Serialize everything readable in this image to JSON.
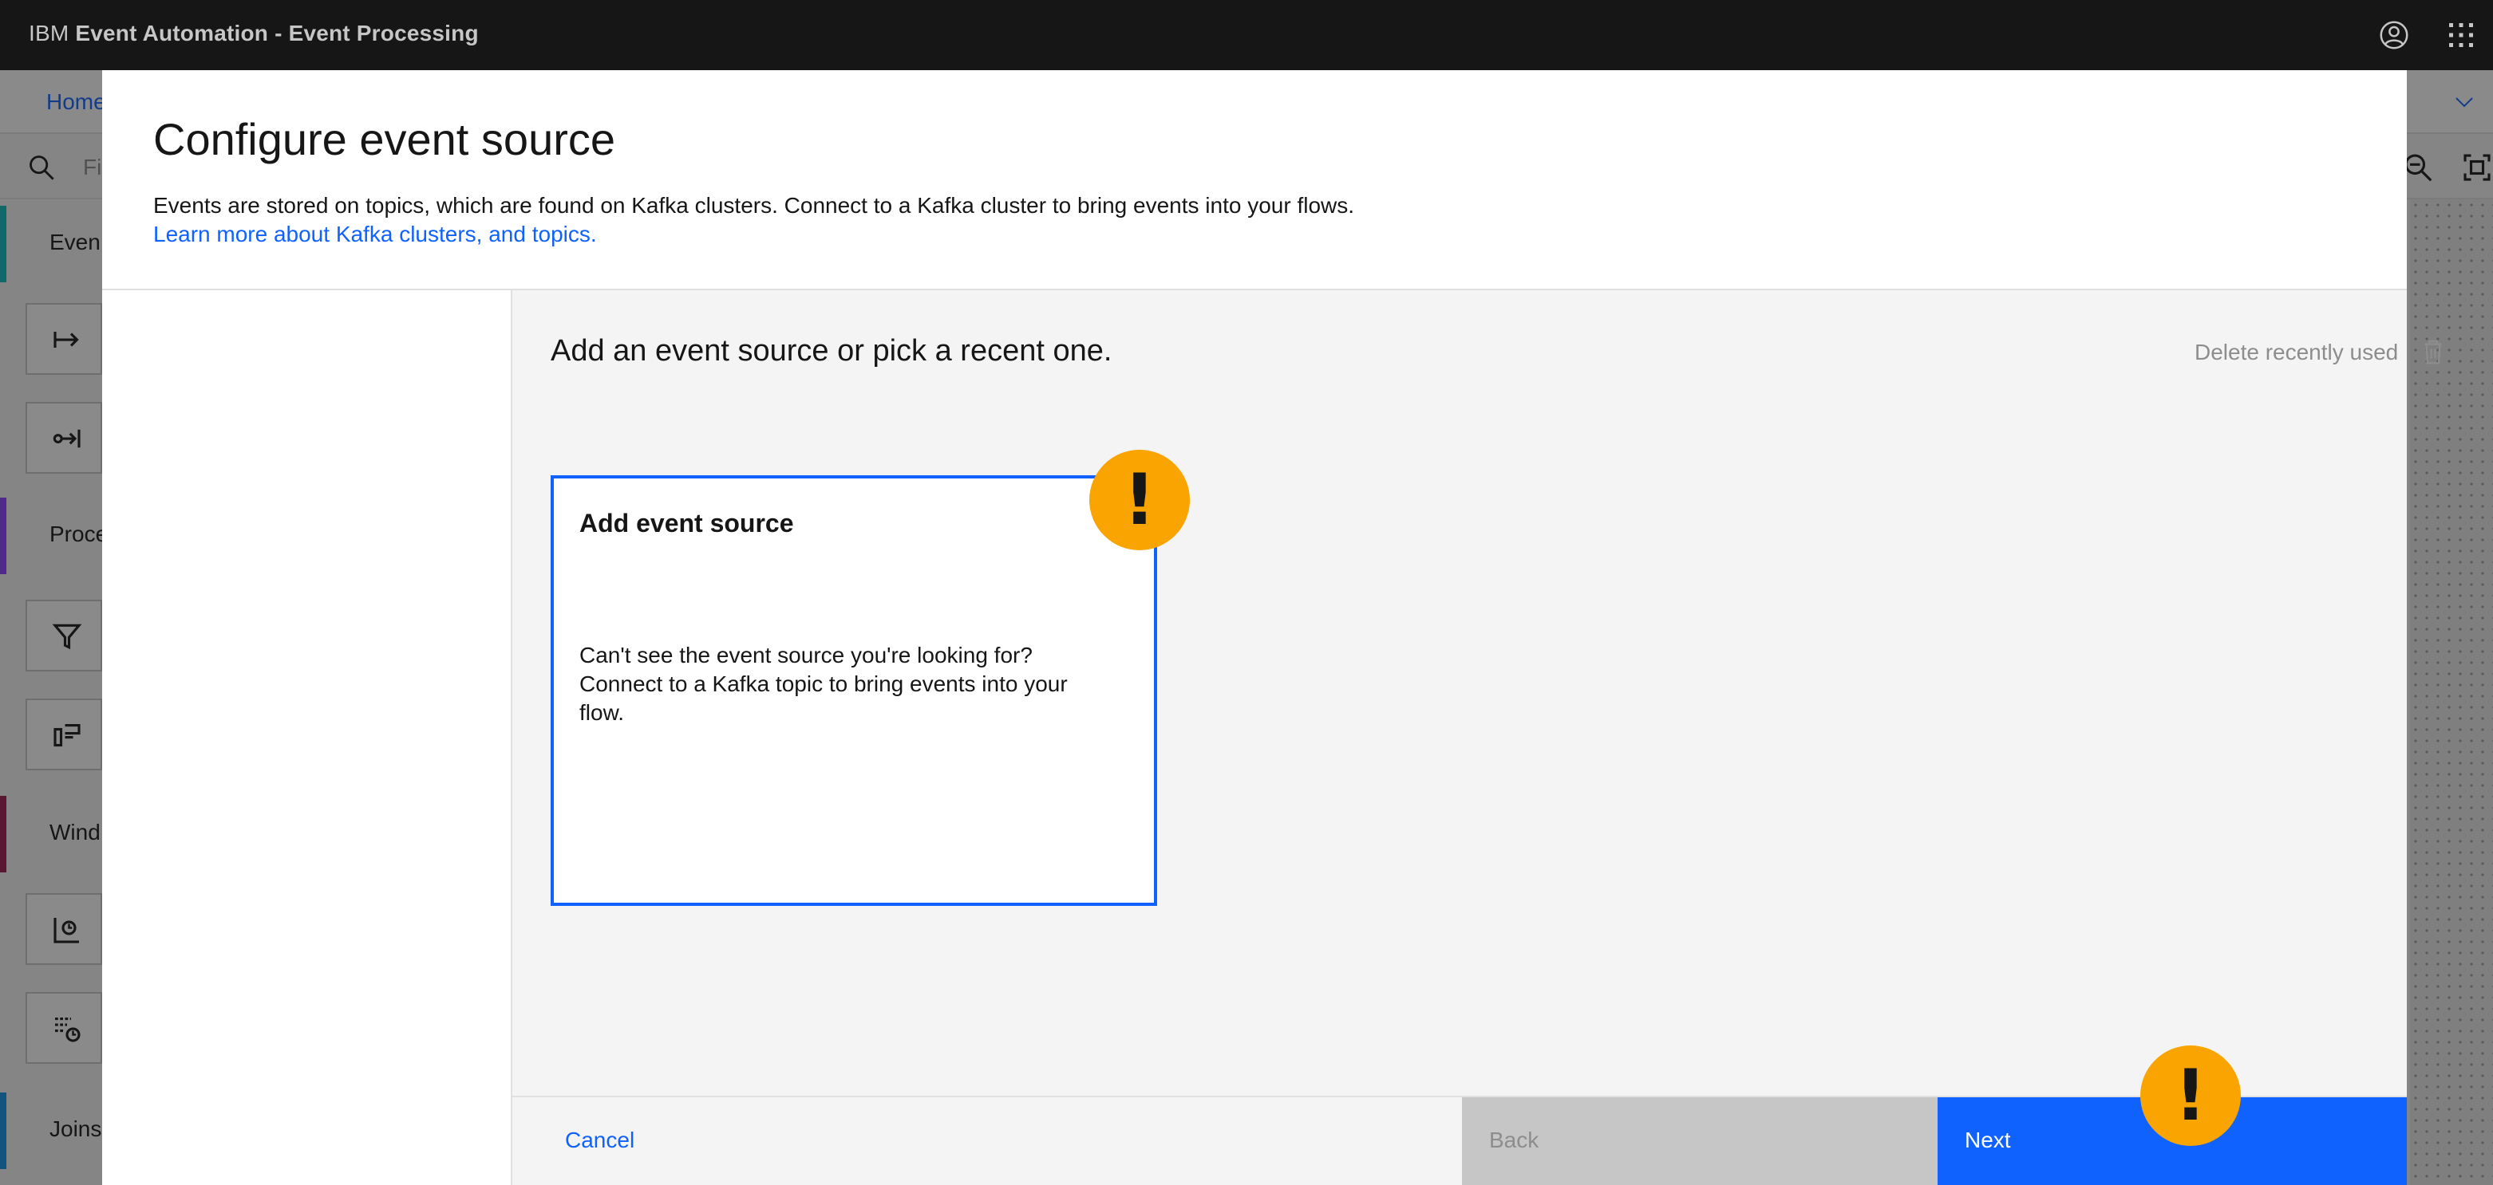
{
  "header": {
    "brand_prefix": "IBM",
    "brand_name": "Event Automation - Event Processing",
    "icons": [
      "user-avatar-icon",
      "app-switcher-icon"
    ]
  },
  "background": {
    "breadcrumb": "Home",
    "filter_placeholder": "Fi",
    "palette_sections": [
      {
        "label": "Even",
        "color": "#08bdba"
      },
      {
        "label": "Proce",
        "color": "#8a3ffc"
      },
      {
        "label": "Wind",
        "color": "#9f1853"
      },
      {
        "label": "Joins",
        "color": "#1192e8"
      }
    ]
  },
  "modal": {
    "title": "Configure event source",
    "description": "Events are stored on topics, which are found on Kafka clusters. Connect to a Kafka cluster to bring events into your flows.",
    "learn_more_link": "Learn more about Kafka clusters, and topics.",
    "content_heading": "Add an event source or pick a recent one.",
    "delete_recent_label": "Delete recently used",
    "add_tile": {
      "title": "Add event source",
      "description": "Can't see the event source you're looking for? Connect to a Kafka topic to bring events into your flow."
    },
    "footer": {
      "cancel_label": "Cancel",
      "back_label": "Back",
      "next_label": "Next"
    }
  },
  "alerts": {
    "mark": "!",
    "color": "#f9a400"
  },
  "colors": {
    "primary": "#0f62fe",
    "header_bg": "#161616"
  }
}
